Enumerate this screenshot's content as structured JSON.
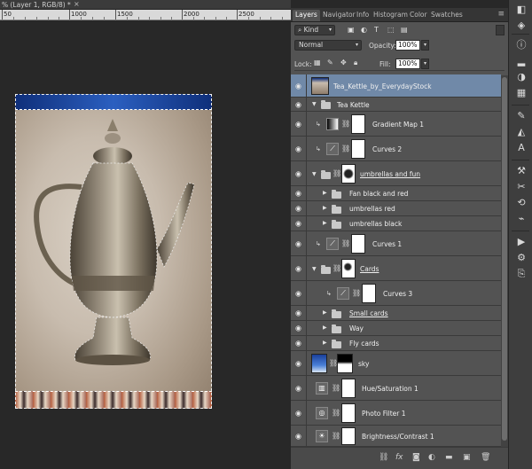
{
  "document": {
    "tab_title": "% (Layer 1, RGB/8) *",
    "close_icon": "×"
  },
  "ruler": {
    "labels": [
      "50",
      "1000",
      "1500",
      "2000",
      "2500"
    ]
  },
  "panel_tabs": [
    "Layers",
    "Navigator",
    "Info",
    "Histogram",
    "Color",
    "Swatches"
  ],
  "filter": {
    "kind_label": "Kind",
    "icons": [
      "image-filter-icon",
      "adjustment-filter-icon",
      "type-filter-icon",
      "shape-filter-icon",
      "smart-object-filter-icon"
    ]
  },
  "blend": {
    "mode": "Normal",
    "opacity_label": "Opacity:",
    "opacity_value": "100%",
    "fill_label": "Fill:",
    "fill_value": "100%",
    "lock_label": "Lock:"
  },
  "layers": [
    {
      "name": "Tea_Kettle_by_EverydayStock",
      "type": "image",
      "selected": true,
      "underline": false
    },
    {
      "name": "Tea Kettle",
      "type": "group",
      "expanded": true,
      "underline": false
    },
    {
      "name": "Gradient Map 1",
      "type": "adjustment",
      "adj": "gradient",
      "clipped": true,
      "underline": false
    },
    {
      "name": "Curves 2",
      "type": "adjustment",
      "adj": "curves",
      "clipped": true,
      "underline": false
    },
    {
      "name": "umbrellas and fun",
      "type": "group-mask",
      "expanded": true,
      "underline": true
    },
    {
      "name": "Fan black and red",
      "type": "group",
      "expanded": false,
      "indent": true,
      "underline": false
    },
    {
      "name": "umbrellas red",
      "type": "group",
      "expanded": false,
      "indent": true,
      "underline": false
    },
    {
      "name": "umbrellas black",
      "type": "group",
      "expanded": false,
      "indent": true,
      "underline": false
    },
    {
      "name": "Curves 1",
      "type": "adjustment",
      "adj": "curves",
      "clipped": true,
      "underline": false
    },
    {
      "name": "Cards",
      "type": "group-mask",
      "expanded": true,
      "underline": true
    },
    {
      "name": "Curves 3",
      "type": "adjustment",
      "adj": "curves",
      "clipped": true,
      "indent": true,
      "underline": false
    },
    {
      "name": "Small cards",
      "type": "group",
      "expanded": false,
      "indent": true,
      "underline": true
    },
    {
      "name": "Way",
      "type": "group",
      "expanded": false,
      "indent": true,
      "underline": false
    },
    {
      "name": "Fly cards",
      "type": "group",
      "expanded": false,
      "indent": true,
      "underline": false
    },
    {
      "name": "sky",
      "type": "image-mask",
      "underline": false
    },
    {
      "name": "Hue/Saturation 1",
      "type": "adjustment",
      "adj": "huesat",
      "underline": false
    },
    {
      "name": "Photo Filter 1",
      "type": "adjustment",
      "adj": "photofilter",
      "underline": false
    },
    {
      "name": "Brightness/Contrast 1",
      "type": "adjustment",
      "adj": "brightness",
      "underline": false
    }
  ],
  "bottom_icons": [
    "link-layers-icon",
    "fx-icon",
    "add-mask-icon",
    "new-adjustment-icon",
    "new-group-icon",
    "new-layer-icon",
    "trash-icon"
  ],
  "dock_icons": [
    "layers-panel-icon",
    "channels-panel-icon",
    "info-panel-icon",
    "histogram-panel-icon",
    "color-panel-icon",
    "swatches-panel-icon",
    "brush-panel-icon",
    "navigator-panel-icon",
    "character-panel-icon",
    "tools-panel-icon",
    "adjustments-panel-icon",
    "history-panel-icon",
    "paths-panel-icon",
    "actions-panel-icon",
    "brush-presets-icon",
    "clone-source-icon"
  ]
}
